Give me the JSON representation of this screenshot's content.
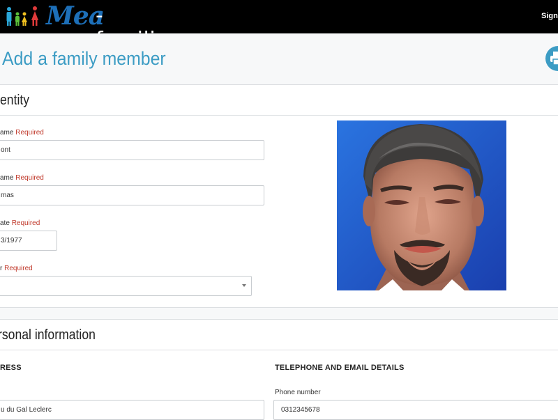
{
  "app": {
    "logo_brand": "Mea",
    "logo_suffix": "-familia",
    "signin_label": "Sign out"
  },
  "header": {
    "title": "Add a family member",
    "print_icon": "printer-icon"
  },
  "identity": {
    "section_title": "entity",
    "required_text": "Required",
    "fields": [
      {
        "label": "ame",
        "value": "ont"
      },
      {
        "label": "ame",
        "value": "mas"
      },
      {
        "label": "ate",
        "value": "3/1977"
      },
      {
        "label": "r",
        "value": ""
      }
    ],
    "photo_alt": "avatar"
  },
  "personal": {
    "section_title": "rsonal information",
    "address": {
      "heading": "RESS",
      "value": "u du Gal Leclerc"
    },
    "contact": {
      "heading": "TELEPHONE AND EMAIL DETAILS",
      "phone_label": "Phone number",
      "phone_value": "0312345678"
    }
  },
  "colors": {
    "accent": "#3c9cc4",
    "required": "#c0392b",
    "topbar": "#000000",
    "logo_blue": "#1d6fb8"
  }
}
